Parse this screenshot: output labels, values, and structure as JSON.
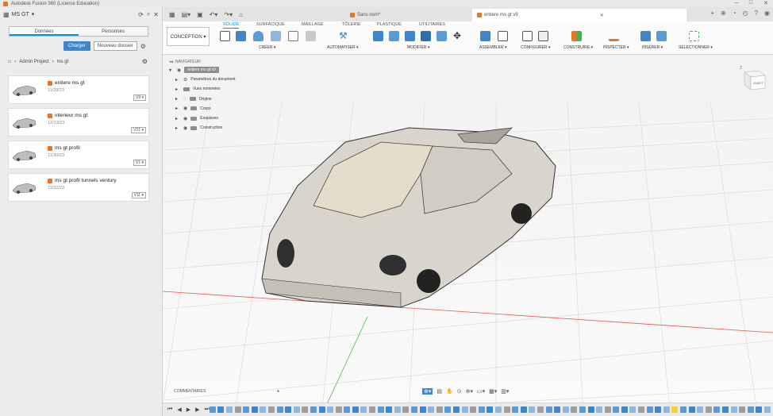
{
  "window": {
    "title": "Autodesk Fusion 360 (Licence Education)"
  },
  "data_panel": {
    "project": "MS GT",
    "tabs": [
      "Données",
      "Personnes"
    ],
    "upload_label": "Charger",
    "new_folder_label": "Nouveau dossier",
    "breadcrumb": [
      "Admin Project",
      "ms gt"
    ],
    "files": [
      {
        "name": "entiere ms gt",
        "date": "11/29/23",
        "version": "V9 ▾"
      },
      {
        "name": "interieur ms gt",
        "date": "12/13/23",
        "version": "V21 ▾"
      },
      {
        "name": "ms gt profil",
        "date": "11/30/23",
        "version": "V1 ▾"
      },
      {
        "name": "ms gt profil tunnels ventury",
        "date": "11/22/23",
        "version": "V11 ▾"
      }
    ]
  },
  "document_tabs": [
    {
      "label": "Sans nom*",
      "active": false
    },
    {
      "label": "entiere ms gt v9",
      "active": true
    }
  ],
  "toolbar": {
    "workspace": "CONCEPTION ▾",
    "tabs": [
      "SOLIDE",
      "SURFACIQUE",
      "MAILLAGE",
      "TÔLERIE",
      "PLASTIQUE",
      "UTILITAIRES"
    ],
    "groups": [
      "CRÉER ▾",
      "AUTOMATISER ▾",
      "MODIFIER ▾",
      "ASSEMBLER ▾",
      "CONFIGURER ▾",
      "CONSTRUIRE ▾",
      "INSPECTER ▾",
      "INSÉRER ▾",
      "SÉLECTIONNER ▾"
    ]
  },
  "navigator": {
    "title": "NAVIGATEUR",
    "root": "entiere ms gt v9",
    "items": [
      "Paramètres du document",
      "Vues nommées",
      "Origine",
      "Corps",
      "Esquisses",
      "Construction"
    ]
  },
  "viewcube": {
    "face": "AVANT",
    "axis": "Z"
  },
  "comments_label": "COMMENTAIRES",
  "colors": {
    "accent": "#0696d7",
    "button": "#3d86c9",
    "brand": "#e87722"
  }
}
